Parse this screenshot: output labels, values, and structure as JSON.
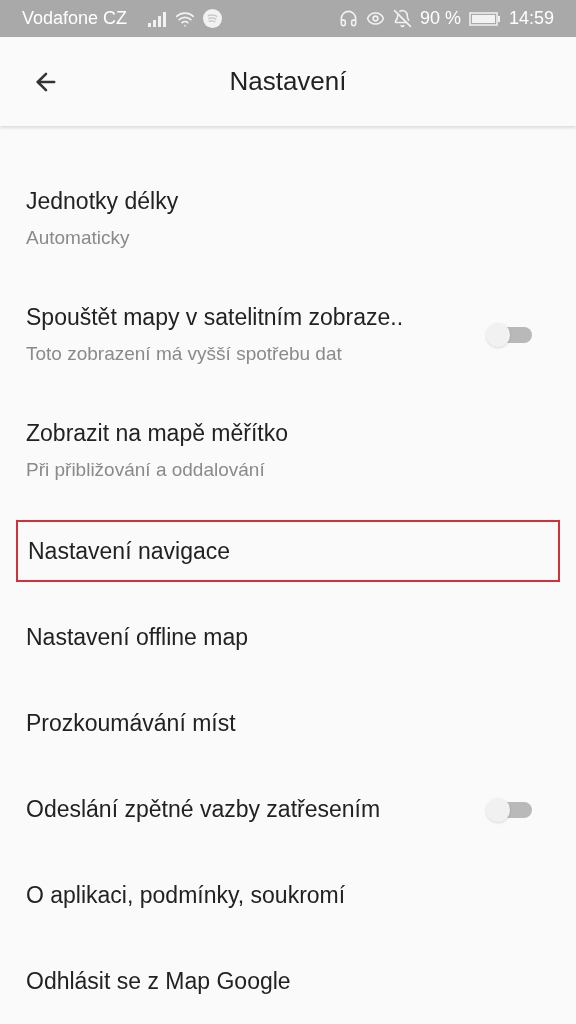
{
  "status_bar": {
    "carrier": "Vodafone CZ",
    "battery": "90 %",
    "time": "14:59"
  },
  "header": {
    "title": "Nastavení"
  },
  "items": [
    {
      "kind": "text",
      "title": "Jednotky délky",
      "subtitle": "Automaticky",
      "highlighted": false
    },
    {
      "kind": "toggle",
      "title": "Spouštět mapy v satelitním zobraze..",
      "subtitle": "Toto zobrazení má vyšší spotřebu dat",
      "on": false,
      "highlighted": false
    },
    {
      "kind": "text",
      "title": "Zobrazit na mapě měřítko",
      "subtitle": "Při přibližování a oddalování",
      "highlighted": false
    },
    {
      "kind": "text",
      "title": "Nastavení navigace",
      "highlighted": true
    },
    {
      "kind": "text",
      "title": "Nastavení offline map",
      "highlighted": false
    },
    {
      "kind": "text",
      "title": "Prozkoumávání míst",
      "highlighted": false
    },
    {
      "kind": "toggle",
      "title": "Odeslání zpětné vazby zatřesením",
      "on": false,
      "highlighted": false
    },
    {
      "kind": "text",
      "title": "O aplikaci, podmínky, soukromí",
      "highlighted": false
    },
    {
      "kind": "text",
      "title": "Odhlásit se z Map Google",
      "highlighted": false
    }
  ]
}
